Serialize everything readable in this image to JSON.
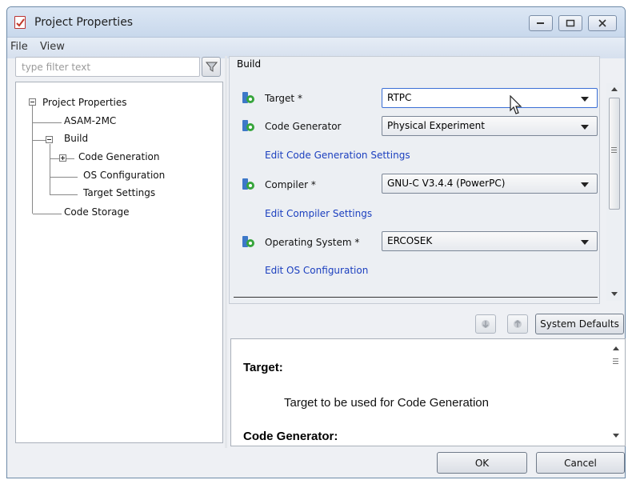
{
  "window": {
    "title": "Project Properties",
    "controls": [
      "minimize",
      "maximize",
      "close"
    ]
  },
  "menu": [
    "File",
    "View"
  ],
  "filter": {
    "placeholder": "type filter text"
  },
  "tree": [
    {
      "label": "Project Properties",
      "toggle": "expanded"
    },
    {
      "label": "ASAM-2MC"
    },
    {
      "label": "Build",
      "toggle": "expanded"
    },
    {
      "label": "Code Generation",
      "toggle": "collapsed"
    },
    {
      "label": "OS Configuration"
    },
    {
      "label": "Target Settings"
    },
    {
      "label": "Code Storage"
    }
  ],
  "build": {
    "section_title": "Build",
    "target": {
      "label": "Target *",
      "value": "RTPC"
    },
    "code_generator": {
      "label": "Code Generator",
      "value": "Physical Experiment",
      "link": "Edit Code Generation Settings"
    },
    "compiler": {
      "label": "Compiler *",
      "value": "GNU-C V3.4.4 (PowerPC)",
      "link": "Edit Compiler Settings"
    },
    "os": {
      "label": "Operating System *",
      "value": "ERCOSEK",
      "link": "Edit OS Configuration"
    }
  },
  "buttons": {
    "system_defaults": "System Defaults",
    "ok": "OK",
    "cancel": "Cancel"
  },
  "help": {
    "heading1": "Target:",
    "text1": "Target to be used for Code Generation",
    "heading2": "Code Generator:"
  },
  "colors": {
    "link": "#1b3fbf",
    "titlebar": "#d0ddef"
  }
}
